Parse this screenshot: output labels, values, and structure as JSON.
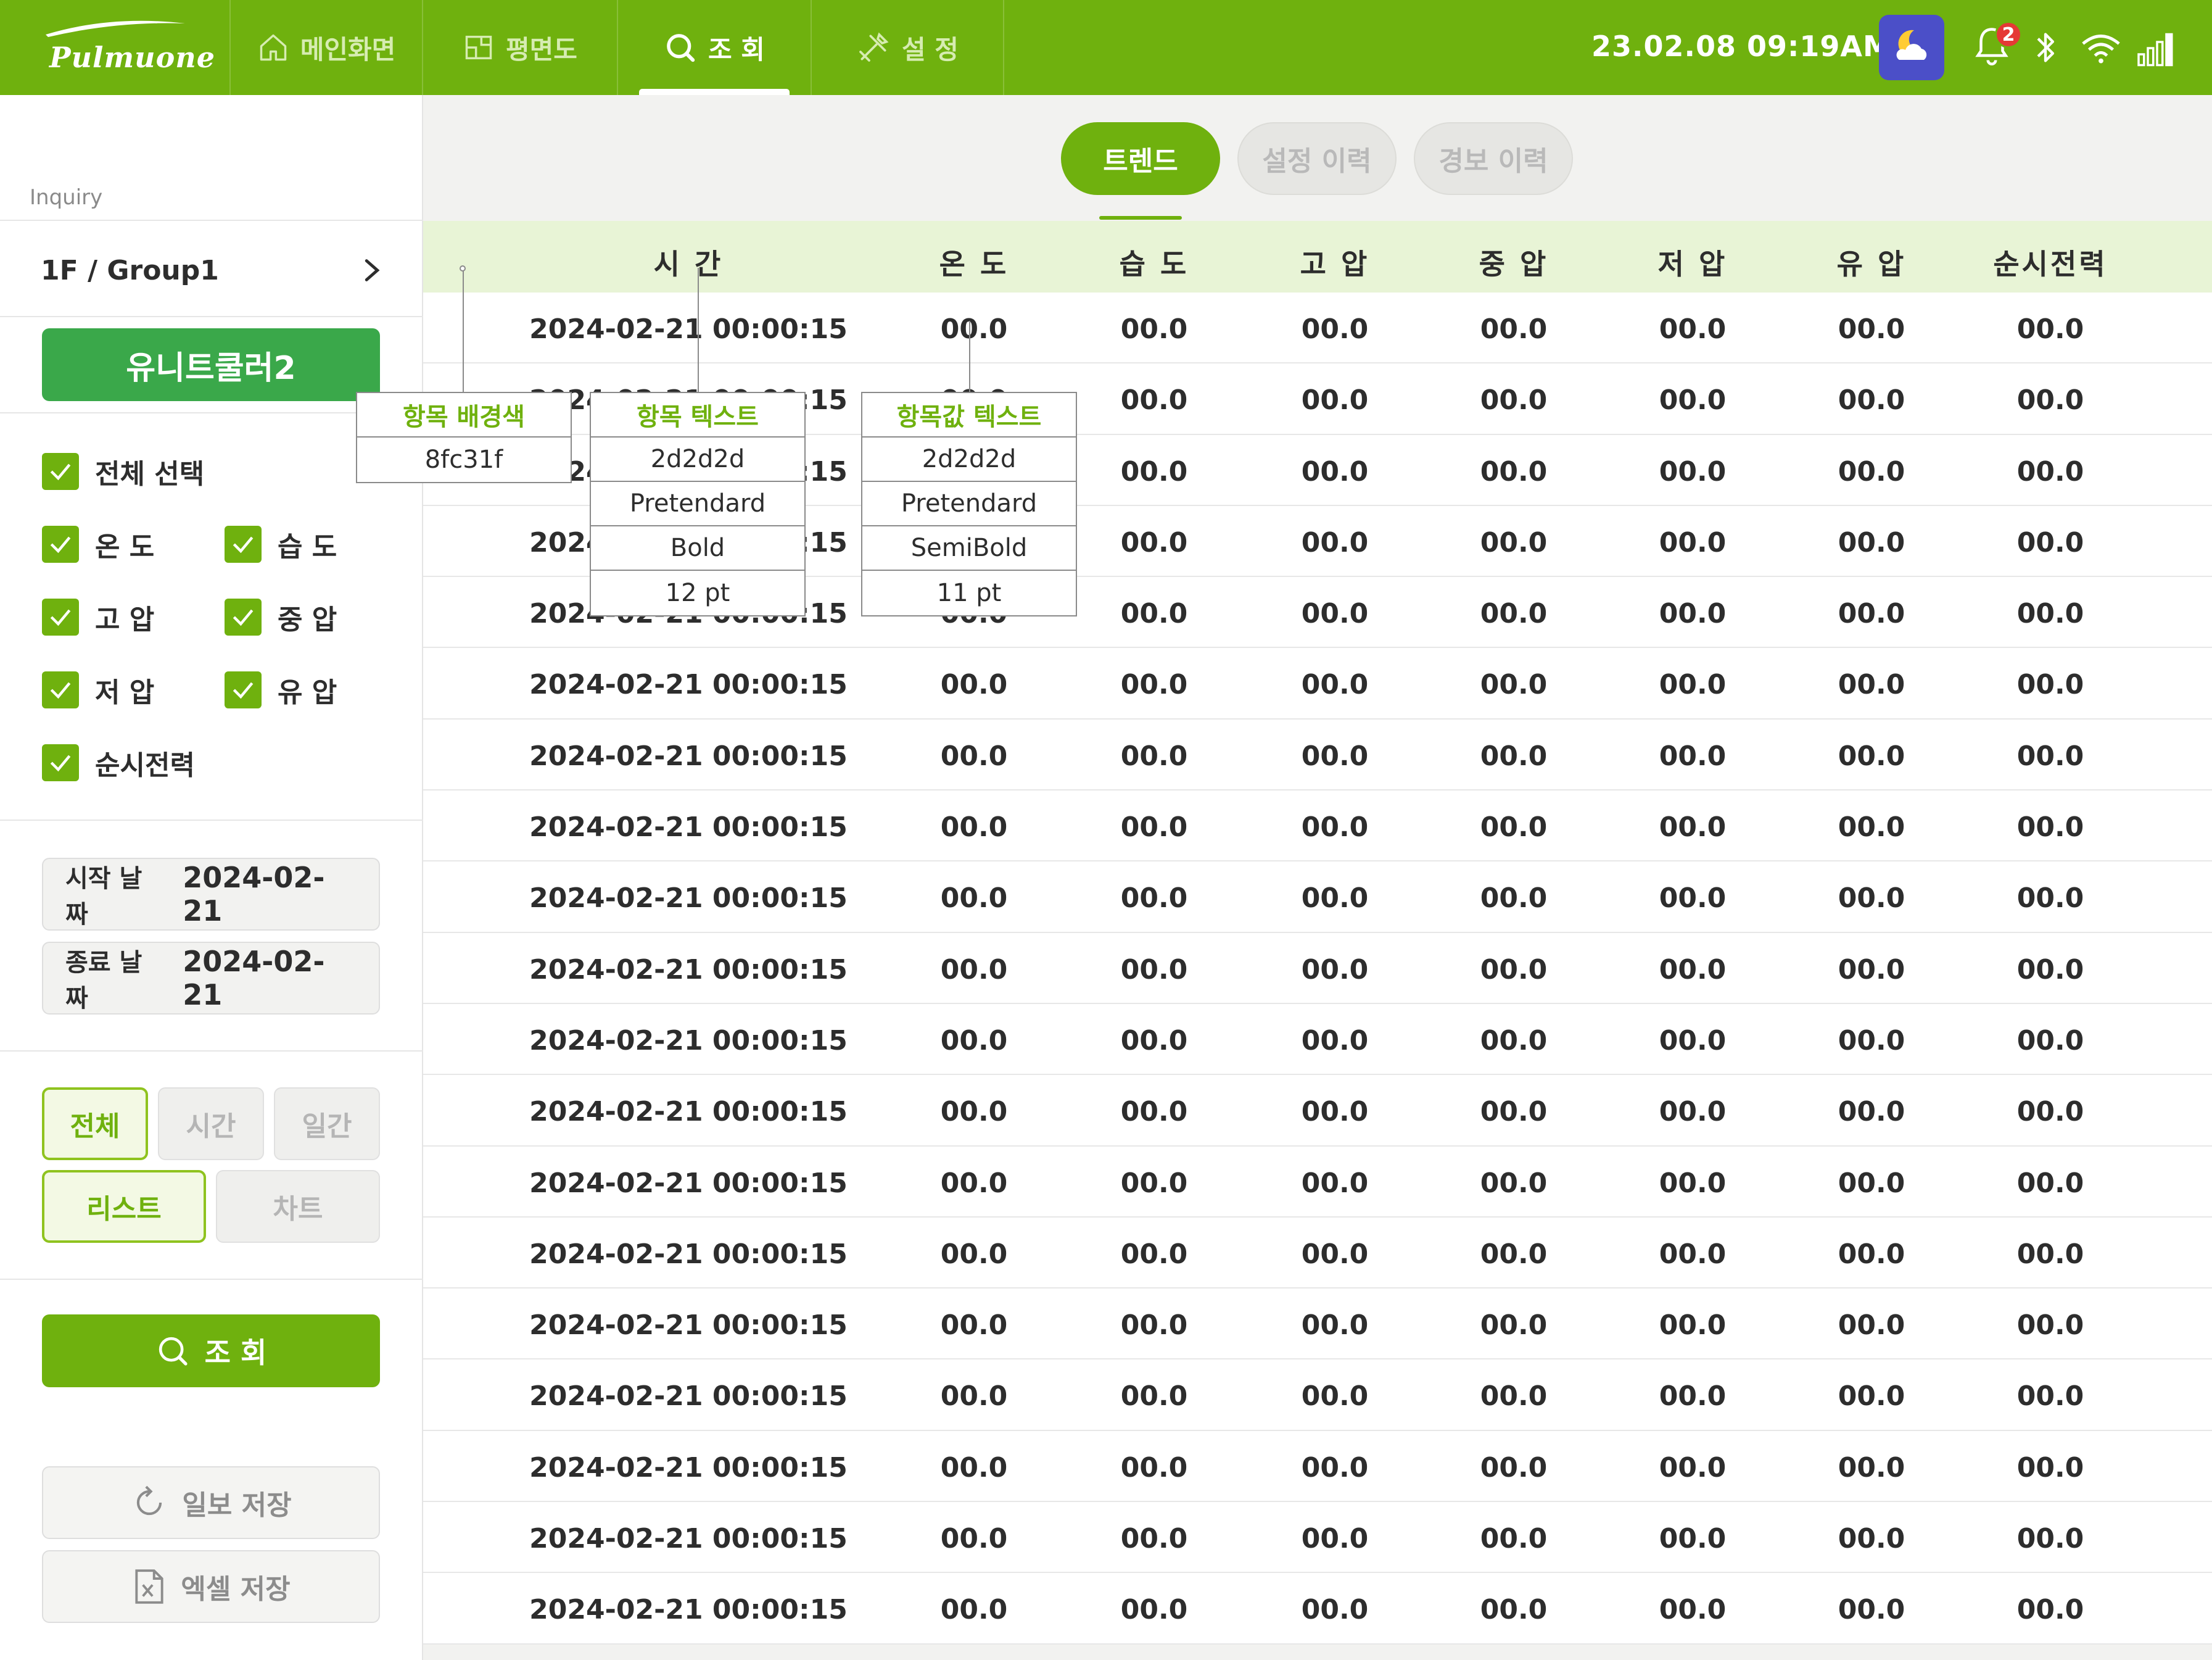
{
  "header": {
    "logo": "Pulmuone",
    "nav": [
      {
        "label": "메인화면",
        "icon": "home-icon"
      },
      {
        "label": "평면도",
        "icon": "floorplan-icon"
      },
      {
        "label": "조 회",
        "icon": "search-icon"
      },
      {
        "label": "설 정",
        "icon": "tools-icon"
      }
    ],
    "datetime": "23.02.08  09:19AM",
    "notification_count": "2",
    "colors": {
      "primary": "#6fb10e",
      "weather_bg": "#4b4fc8",
      "badge": "#e53935"
    }
  },
  "sidebar": {
    "section_label": "Inquiry",
    "group": "1F / Group1",
    "unit_button": "유니트쿨러2",
    "select_all": "전체 선택",
    "checks": [
      "온 도",
      "습 도",
      "고 압",
      "중 압",
      "저 압",
      "유 압",
      "순시전력"
    ],
    "start_date_label": "시작 날짜",
    "start_date": "2024-02-21",
    "end_date_label": "종료 날짜",
    "end_date": "2024-02-21",
    "period": [
      "전체",
      "시간",
      "일간"
    ],
    "views": [
      "리스트",
      "차트"
    ],
    "search_button": "조 회",
    "daily_report_button": "일보 저장",
    "excel_button": "엑셀 저장"
  },
  "main": {
    "tabs": [
      "트렌드",
      "설정 이력",
      "경보 이력"
    ],
    "columns": [
      "시 간",
      "온 도",
      "습 도",
      "고 압",
      "중 압",
      "저 압",
      "유 압",
      "순시전력"
    ],
    "rows": [
      [
        "2024-02-21 00:00:15",
        "00.0",
        "00.0",
        "00.0",
        "00.0",
        "00.0",
        "00.0",
        "00.0"
      ],
      [
        "2024-02-21 00:00:15",
        "00.0",
        "00.0",
        "00.0",
        "00.0",
        "00.0",
        "00.0",
        "00.0"
      ],
      [
        "2024-02-21 00:00:15",
        "00.0",
        "00.0",
        "00.0",
        "00.0",
        "00.0",
        "00.0",
        "00.0"
      ],
      [
        "2024-02-21 00:00:15",
        "00.0",
        "00.0",
        "00.0",
        "00.0",
        "00.0",
        "00.0",
        "00.0"
      ],
      [
        "2024-02-21 00:00:15",
        "00.0",
        "00.0",
        "00.0",
        "00.0",
        "00.0",
        "00.0",
        "00.0"
      ],
      [
        "2024-02-21 00:00:15",
        "00.0",
        "00.0",
        "00.0",
        "00.0",
        "00.0",
        "00.0",
        "00.0"
      ],
      [
        "2024-02-21 00:00:15",
        "00.0",
        "00.0",
        "00.0",
        "00.0",
        "00.0",
        "00.0",
        "00.0"
      ],
      [
        "2024-02-21 00:00:15",
        "00.0",
        "00.0",
        "00.0",
        "00.0",
        "00.0",
        "00.0",
        "00.0"
      ],
      [
        "2024-02-21 00:00:15",
        "00.0",
        "00.0",
        "00.0",
        "00.0",
        "00.0",
        "00.0",
        "00.0"
      ],
      [
        "2024-02-21 00:00:15",
        "00.0",
        "00.0",
        "00.0",
        "00.0",
        "00.0",
        "00.0",
        "00.0"
      ],
      [
        "2024-02-21 00:00:15",
        "00.0",
        "00.0",
        "00.0",
        "00.0",
        "00.0",
        "00.0",
        "00.0"
      ],
      [
        "2024-02-21 00:00:15",
        "00.0",
        "00.0",
        "00.0",
        "00.0",
        "00.0",
        "00.0",
        "00.0"
      ],
      [
        "2024-02-21 00:00:15",
        "00.0",
        "00.0",
        "00.0",
        "00.0",
        "00.0",
        "00.0",
        "00.0"
      ],
      [
        "2024-02-21 00:00:15",
        "00.0",
        "00.0",
        "00.0",
        "00.0",
        "00.0",
        "00.0",
        "00.0"
      ],
      [
        "2024-02-21 00:00:15",
        "00.0",
        "00.0",
        "00.0",
        "00.0",
        "00.0",
        "00.0",
        "00.0"
      ],
      [
        "2024-02-21 00:00:15",
        "00.0",
        "00.0",
        "00.0",
        "00.0",
        "00.0",
        "00.0",
        "00.0"
      ],
      [
        "2024-02-21 00:00:15",
        "00.0",
        "00.0",
        "00.0",
        "00.0",
        "00.0",
        "00.0",
        "00.0"
      ],
      [
        "2024-02-21 00:00:15",
        "00.0",
        "00.0",
        "00.0",
        "00.0",
        "00.0",
        "00.0",
        "00.0"
      ],
      [
        "2024-02-21 00:00:15",
        "00.0",
        "00.0",
        "00.0",
        "00.0",
        "00.0",
        "00.0",
        "00.0"
      ]
    ]
  },
  "annotations": [
    {
      "title": "항목 배경색",
      "lines": [
        "8fc31f"
      ]
    },
    {
      "title": "항목 텍스트",
      "lines": [
        "2d2d2d",
        "Pretendard",
        "Bold",
        "12 pt"
      ]
    },
    {
      "title": "항목값 텍스트",
      "lines": [
        "2d2d2d",
        "Pretendard",
        "SemiBold",
        "11 pt"
      ]
    }
  ]
}
